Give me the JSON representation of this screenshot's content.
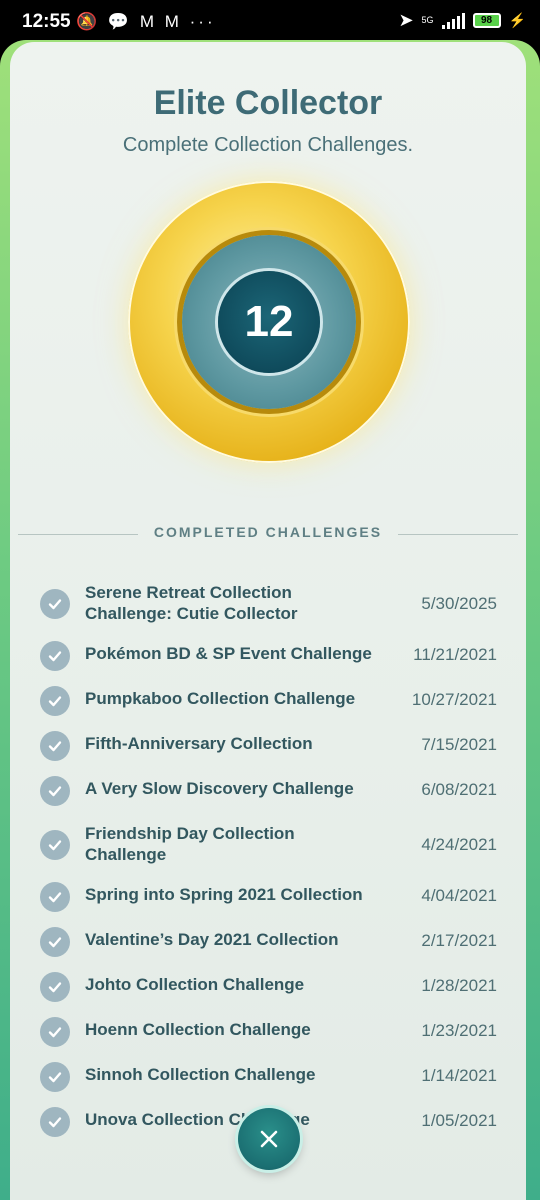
{
  "status_bar": {
    "time": "12:55",
    "network": "5G",
    "battery": "98",
    "left_icons": [
      "notification-muted-icon",
      "chat-icon",
      "gmail-icon",
      "gmail-icon",
      "more-icon"
    ]
  },
  "page": {
    "title": "Elite Collector",
    "subtitle": "Complete Collection Challenges.",
    "medal_count": "12",
    "section_title": "COMPLETED CHALLENGES"
  },
  "challenges": [
    {
      "name": "Serene Retreat Collection Challenge: Cutie Collector",
      "date": "5/30/2025"
    },
    {
      "name": "Pokémon BD & SP Event Challenge",
      "date": "11/21/2021"
    },
    {
      "name": "Pumpkaboo Collection Challenge",
      "date": "10/27/2021"
    },
    {
      "name": "Fifth-Anniversary Collection",
      "date": "7/15/2021"
    },
    {
      "name": "A Very Slow Discovery Challenge",
      "date": "6/08/2021"
    },
    {
      "name": "Friendship Day Collection Challenge",
      "date": "4/24/2021"
    },
    {
      "name": "Spring into Spring 2021 Collection",
      "date": "4/04/2021"
    },
    {
      "name": "Valentine’s Day 2021 Collection",
      "date": "2/17/2021"
    },
    {
      "name": "Johto Collection Challenge",
      "date": "1/28/2021"
    },
    {
      "name": "Hoenn Collection Challenge",
      "date": "1/23/2021"
    },
    {
      "name": "Sinnoh Collection Challenge",
      "date": "1/14/2021"
    },
    {
      "name": "Unova Collection Challenge",
      "date": "1/05/2021"
    }
  ],
  "colors": {
    "title": "#3e6b76",
    "medal_gold": "#f6d34b",
    "check": "#9fb6c0",
    "close_button": "#1b6f72"
  }
}
